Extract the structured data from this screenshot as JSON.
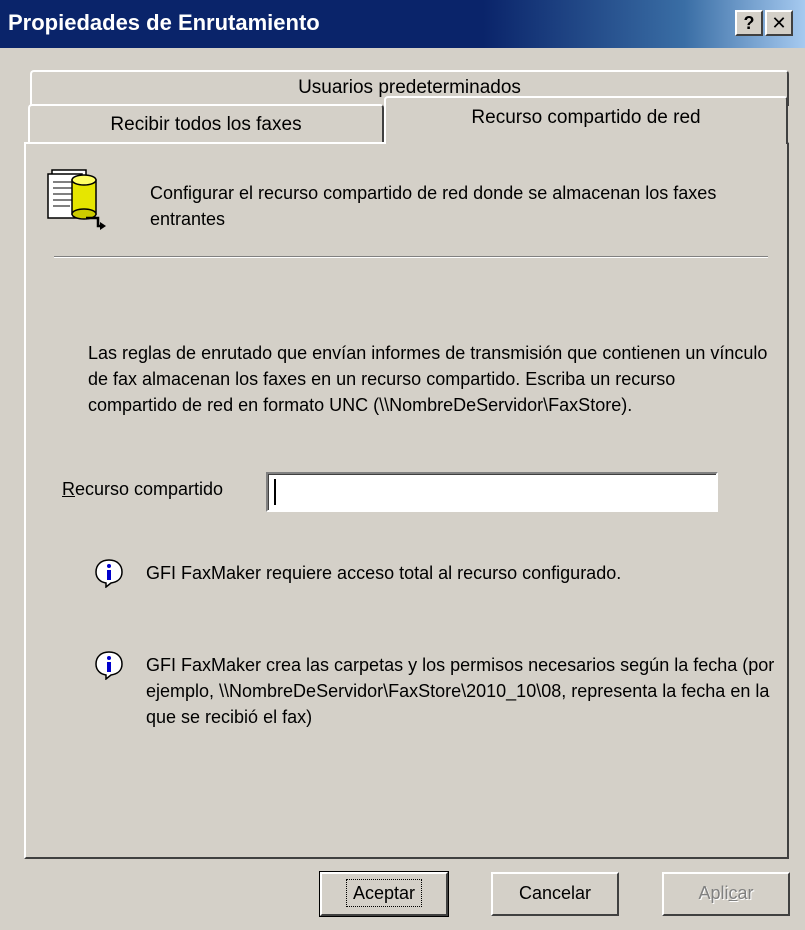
{
  "window": {
    "title": "Propiedades de Enrutamiento",
    "help_button": "?",
    "close_button": "✕"
  },
  "tabs": [
    {
      "label": "Usuarios predeterminados",
      "active": false
    },
    {
      "label": "Recibir todos los faxes",
      "active": false
    },
    {
      "label": "Recurso compartido de red",
      "active": true
    }
  ],
  "header": {
    "icon": "network-share-database-icon",
    "text": "Configurar el recurso compartido de red donde se almacenan los faxes entrantes"
  },
  "description": "Las reglas de enrutado que envían informes de transmisión que contienen un vínculo de fax almacenan los faxes en un recurso compartido. Escriba un recurso compartido de red en formato UNC (\\\\NombreDeServidor\\FaxStore).",
  "share": {
    "label_first": "R",
    "label_rest": "ecurso compartido",
    "value": ""
  },
  "notes": [
    {
      "icon": "info-icon",
      "text": "GFI FaxMaker requiere acceso total al recurso configurado."
    },
    {
      "icon": "info-icon",
      "text": "GFI FaxMaker crea las carpetas y los permisos necesarios según la fecha (por ejemplo, \\\\NombreDeServidor\\FaxStore\\2010_10\\08, representa la fecha en la que se recibió el fax)"
    }
  ],
  "buttons": {
    "ok": "Aceptar",
    "cancel": "Cancelar",
    "apply_before": "Apli",
    "apply_underlined": "c",
    "apply_after": "ar",
    "apply_enabled": false
  }
}
